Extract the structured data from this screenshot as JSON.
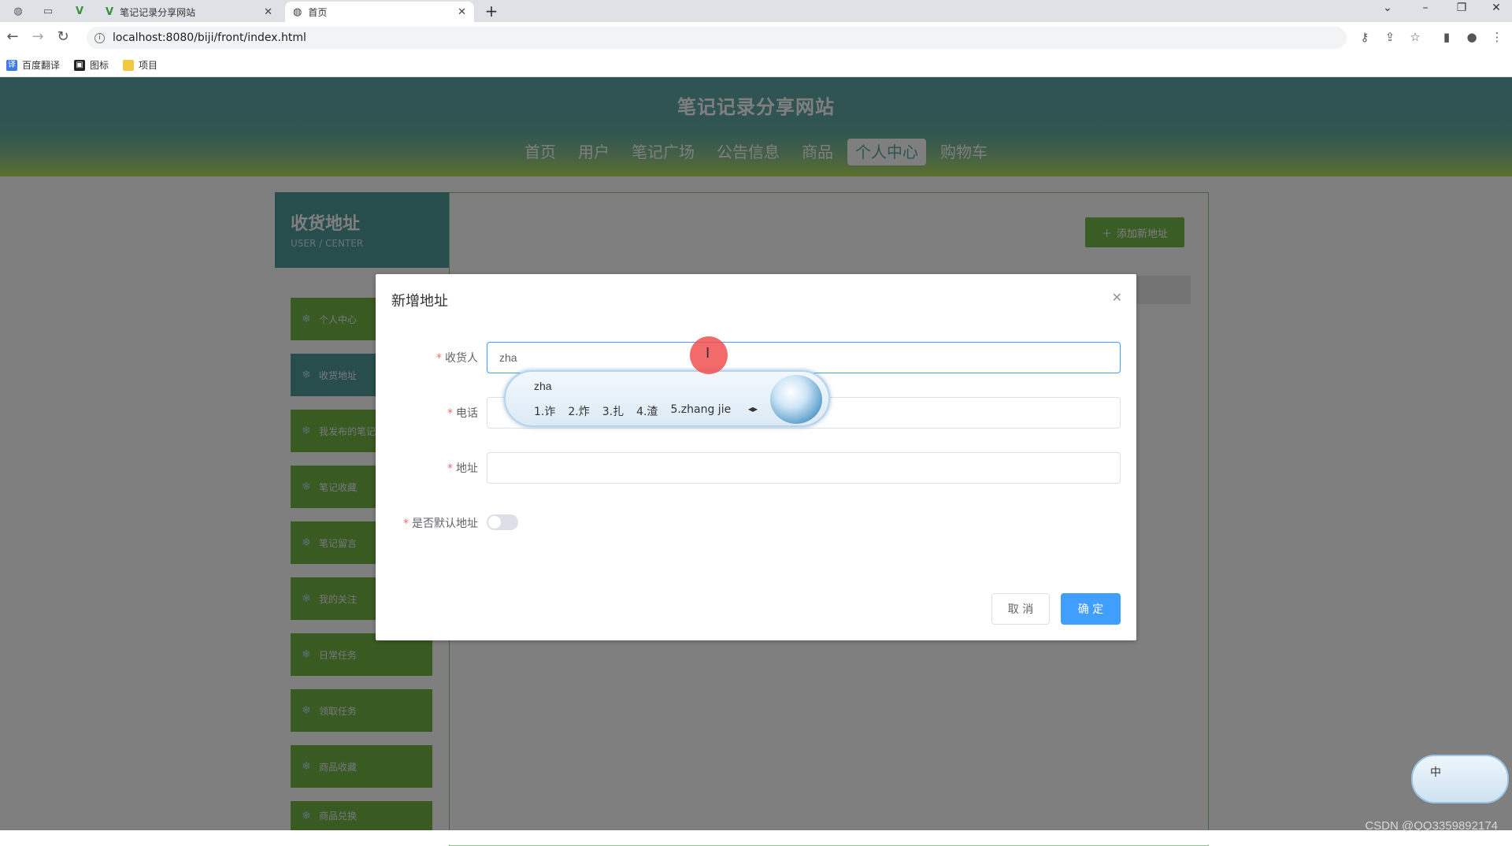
{
  "browser": {
    "tabs": [
      {
        "label": "笔记记录分享网站",
        "active": false
      },
      {
        "label": "首页",
        "active": true
      }
    ],
    "url": "localhost:8080/biji/front/index.html",
    "bookmarks": [
      "百度翻译",
      "图标",
      "项目"
    ]
  },
  "site": {
    "title": "笔记记录分享网站",
    "nav": [
      "首页",
      "用户",
      "笔记广场",
      "公告信息",
      "商品",
      "个人中心",
      "购物车"
    ],
    "active_nav": "个人中心"
  },
  "sidebar": {
    "heading": "收货地址",
    "subheading": "USER / CENTER",
    "items": [
      "个人中心",
      "收货地址",
      "我发布的笔记",
      "笔记收藏",
      "笔记留言",
      "我的关注",
      "日常任务",
      "领取任务",
      "商品收藏",
      "商品兑换"
    ]
  },
  "main": {
    "add_button": "添加新地址"
  },
  "dialog": {
    "title": "新增地址",
    "fields": [
      {
        "label": "收货人",
        "value": "zha",
        "required": true
      },
      {
        "label": "电话",
        "value": "",
        "required": true
      },
      {
        "label": "地址",
        "value": "",
        "required": true
      }
    ],
    "default_label": "是否默认地址",
    "default_on": false,
    "cancel_label": "取 消",
    "ok_label": "确 定"
  },
  "ime": {
    "composition": "zha",
    "candidates": [
      "1.诈",
      "2.炸",
      "3.扎",
      "4.渣",
      "5.zhang jie"
    ],
    "mini_label": "中"
  },
  "watermark": "CSDN @QQ3359892174",
  "colors": {
    "primary": "#409eff",
    "teal": "#4e9a9a",
    "green": "#72b442",
    "required": "#f56c6c"
  }
}
